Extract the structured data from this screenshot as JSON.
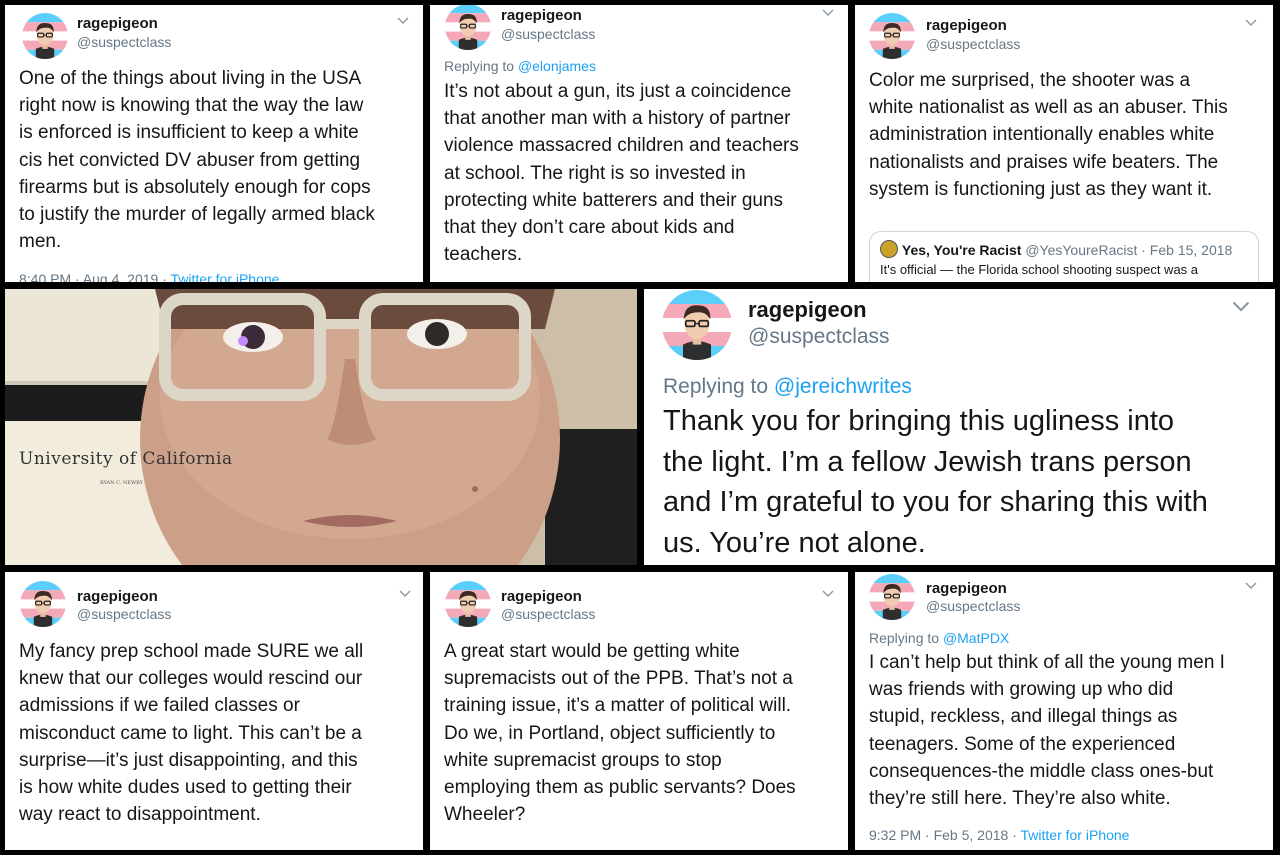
{
  "author": {
    "name": "ragepigeon",
    "handle": "@suspectclass"
  },
  "tweets": {
    "t1": {
      "text": "One of the things about living in the USA\nright now is knowing that the way the law\nis enforced is insufficient to keep a white\ncis het convicted DV abuser from getting\nfirearms but is absolutely enough for cops\nto justify the murder of legally armed black\nmen.",
      "time": "8:40 PM · Aug 4, 2019 · ",
      "source": "Twitter for iPhone"
    },
    "t2": {
      "reply_prefix": "Replying to ",
      "reply_to": "@elonjames",
      "text": "It’s not about a gun, its just a coincidence\nthat another man with a history of partner\nviolence massacred children and teachers\nat school. The right is so invested in\nprotecting white batterers and their guns\nthat they don’t care about kids and\nteachers."
    },
    "t3": {
      "text": "Color me surprised, the shooter was a\nwhite nationalist as well as an abuser. This\nadministration intentionally enables white\nnationalists and praises wife beaters. The\nsystem is functioning just as they want it.",
      "quote": {
        "name": "Yes, You're Racist",
        "handle": "@YesYoureRacist",
        "date": " · Feb 15, 2018",
        "text": "It's official — the Florida school shooting suspect was a"
      }
    },
    "t4": {
      "reply_prefix": "Replying to ",
      "reply_to": "@jereichwrites",
      "text": "Thank you for bringing this ugliness into\nthe light. I’m a fellow Jewish trans person\nand I’m grateful to you for sharing this with\nus. You’re not alone."
    },
    "t5": {
      "text": "My fancy prep school made SURE we all\nknew that our colleges would rescind our\nadmissions if we failed classes or\nmisconduct came to light. This can’t be a\nsurprise—it’s just disappointing, and this\nis how white dudes used to getting their\nway react to disappointment."
    },
    "t6": {
      "text": "A great start would be getting white\nsupremacists out of the PPB. That’s not a\ntraining issue, it’s a matter of political will.\nDo we, in Portland, object sufficiently to\nwhite supremacist groups to stop\nemploying them as public servants? Does\nWheeler?"
    },
    "t7": {
      "reply_prefix": "Replying to ",
      "reply_to": "@MatPDX",
      "text": "I can’t help but think of all the young men I\nwas friends with growing up who did\nstupid, reckless, and illegal things as\nteenagers. Some of the experienced\nconsequences-the middle class ones-but\nthey’re still here. They’re also white.",
      "time": "9:32 PM · Feb 5, 2018 · ",
      "source": "Twitter for iPhone"
    }
  },
  "photo": {
    "diploma_title": "University of California",
    "diploma_line": "RYAN C. NEWBY"
  },
  "icons": {
    "menu": "chevron-down-icon"
  },
  "colors": {
    "link": "#1da1f2",
    "muted": "#657786",
    "text": "#14171a"
  }
}
